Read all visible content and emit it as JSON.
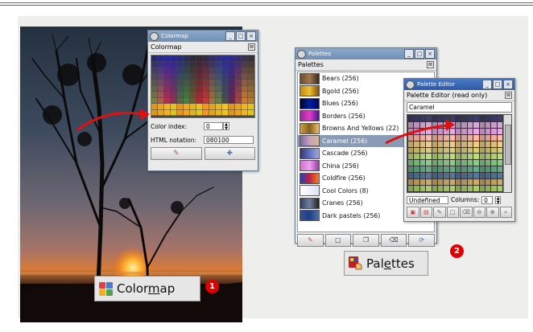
{
  "colormap_dialog": {
    "title": "Colormap",
    "tab_label": "Colormap",
    "color_index_label": "Color index:",
    "color_index_value": "0",
    "html_notation_label": "HTML notation:",
    "html_notation_value": "080100",
    "close_symbol": "⊠"
  },
  "palettes_dialog": {
    "title": "Palettes",
    "tab_label": "Palettes",
    "items": [
      {
        "label": "Bears (256)",
        "colors": [
          "#6b4b2a",
          "#a07850",
          "#3a2a1a"
        ]
      },
      {
        "label": "Bgold (256)",
        "colors": [
          "#c08a10",
          "#f0c030",
          "#805010"
        ]
      },
      {
        "label": "Blues (256)",
        "colors": [
          "#000030",
          "#0020a0",
          "#000060"
        ]
      },
      {
        "label": "Borders (256)",
        "colors": [
          "#a020a0",
          "#e040c0",
          "#5010a0"
        ]
      },
      {
        "label": "Browns And Yellows (22)",
        "colors": [
          "#d0a040",
          "#806020",
          "#f0c060"
        ]
      },
      {
        "label": "Caramel (256)",
        "colors": [
          "#7a6aa0",
          "#c8a0c0",
          "#d8b890"
        ]
      },
      {
        "label": "Cascade (256)",
        "colors": [
          "#303870",
          "#6070c0",
          "#a0a8e0"
        ]
      },
      {
        "label": "China (256)",
        "colors": [
          "#d070d0",
          "#f0a0f0",
          "#9040a0"
        ]
      },
      {
        "label": "Coldfire (256)",
        "colors": [
          "#2040c0",
          "#c02040",
          "#f08020"
        ]
      },
      {
        "label": "Cool Colors (8)",
        "colors": [
          "#ffffff",
          "#f0f0ff",
          "#e0e0f0"
        ]
      },
      {
        "label": "Cranes (256)",
        "colors": [
          "#304060",
          "#7080a0",
          "#202020"
        ]
      },
      {
        "label": "Dark pastels (256)",
        "colors": [
          "#3050a0",
          "#204080",
          "#5070b0"
        ]
      }
    ],
    "selected_index": 5
  },
  "palette_editor": {
    "title": "Palette Editor",
    "header": "Palette Editor (read only)",
    "name_value": "Caramel",
    "entry_label": "Undefined",
    "columns_label": "Columns:",
    "columns_value": "0"
  },
  "labels": {
    "colormap_text_before": "Color",
    "colormap_text_underline": "m",
    "colormap_text_after": "ap",
    "colormap_badge": "1",
    "palettes_text_before": "Pal",
    "palettes_text_underline": "e",
    "palettes_text_after": "ttes",
    "palettes_badge": "2"
  },
  "colors": {
    "arrow": "#e01010",
    "badge": "#e00000",
    "selection": "#8a9bb5",
    "title_active": "#2d5aa6"
  }
}
